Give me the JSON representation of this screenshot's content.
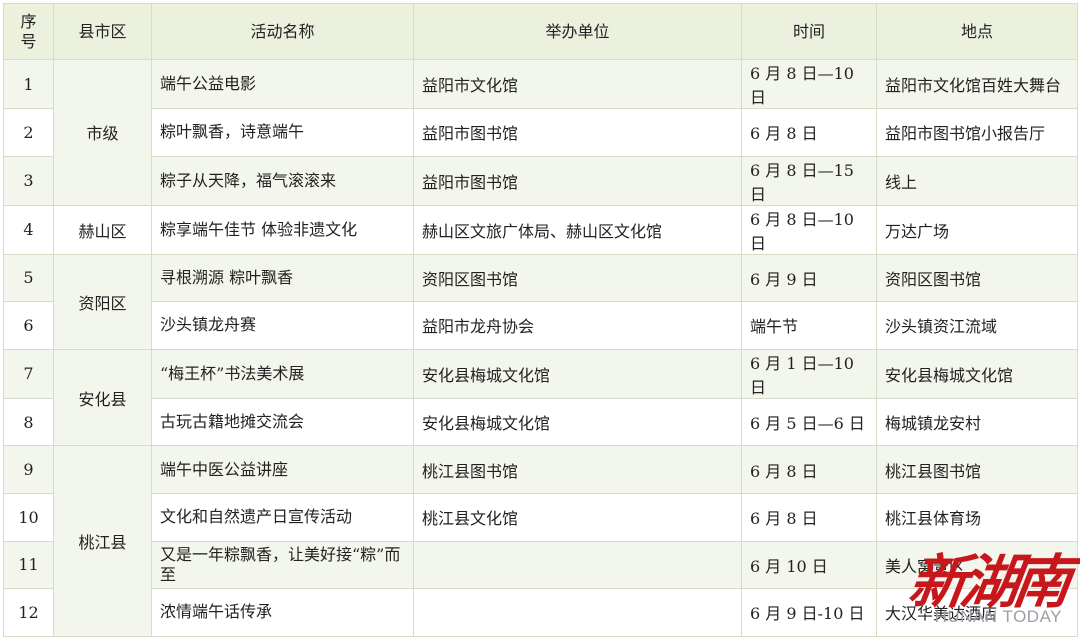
{
  "headers": {
    "seq": "序号",
    "county": "县市区",
    "activity": "活动名称",
    "organizer": "举办单位",
    "time": "时间",
    "place": "地点"
  },
  "groups": [
    {
      "county": "市级",
      "rows": [
        {
          "seq": "1",
          "activity": "端午公益电影",
          "organizer": "益阳市文化馆",
          "time": "6 月 8 日—10 日",
          "place": "益阳市文化馆百姓大舞台"
        },
        {
          "seq": "2",
          "activity": "粽叶飘香，诗意端午",
          "organizer": "益阳市图书馆",
          "time": "6 月 8 日",
          "place": "益阳市图书馆小报告厅"
        },
        {
          "seq": "3",
          "activity": "粽子从天降，福气滚滚来",
          "organizer": "益阳市图书馆",
          "time": "6 月 8 日—15 日",
          "place": "线上"
        }
      ]
    },
    {
      "county": "赫山区",
      "rows": [
        {
          "seq": "4",
          "activity": "粽享端午佳节 体验非遗文化",
          "organizer": "赫山区文旅广体局、赫山区文化馆",
          "time": "6 月 8 日—10 日",
          "place": "万达广场"
        }
      ]
    },
    {
      "county": "资阳区",
      "rows": [
        {
          "seq": "5",
          "activity": "寻根溯源 粽叶飘香",
          "organizer": "资阳区图书馆",
          "time": "6 月 9 日",
          "place": "资阳区图书馆"
        },
        {
          "seq": "6",
          "activity": "沙头镇龙舟赛",
          "organizer": "益阳市龙舟协会",
          "time": "端午节",
          "place": "沙头镇资江流域"
        }
      ]
    },
    {
      "county": "安化县",
      "rows": [
        {
          "seq": "7",
          "activity": "“梅王杯”书法美术展",
          "organizer": "安化县梅城文化馆",
          "time": "6 月 1 日—10 日",
          "place": "安化县梅城文化馆"
        },
        {
          "seq": "8",
          "activity": "古玩古籍地摊交流会",
          "organizer": "安化县梅城文化馆",
          "time": "6 月 5 日—6 日",
          "place": "梅城镇龙安村"
        }
      ]
    },
    {
      "county": "桃江县",
      "rows": [
        {
          "seq": "9",
          "activity": "端午中医公益讲座",
          "organizer": "桃江县图书馆",
          "time": "6 月 8 日",
          "place": "桃江县图书馆"
        },
        {
          "seq": "10",
          "activity": "文化和自然遗产日宣传活动",
          "organizer": "桃江县文化馆",
          "time": "6 月 8 日",
          "place": "桃江县体育场"
        },
        {
          "seq": "11",
          "activity": "又是一年粽飘香，让美好接“粽”而至",
          "organizer": "",
          "time": "6 月 10 日",
          "place": "美人窝景区"
        },
        {
          "seq": "12",
          "activity": "浓情端午话传承",
          "organizer": "",
          "time": "6 月 9 日-10 日",
          "place": "大汉华美达酒店"
        }
      ]
    }
  ],
  "watermark": {
    "cn": "新湖南",
    "en": "HUNAN TODAY",
    "color": "#c8161d"
  },
  "colors": {
    "header_bg": "#ecf1de",
    "band_bg": "#f3f6ec",
    "border": "#d6dcc8"
  }
}
